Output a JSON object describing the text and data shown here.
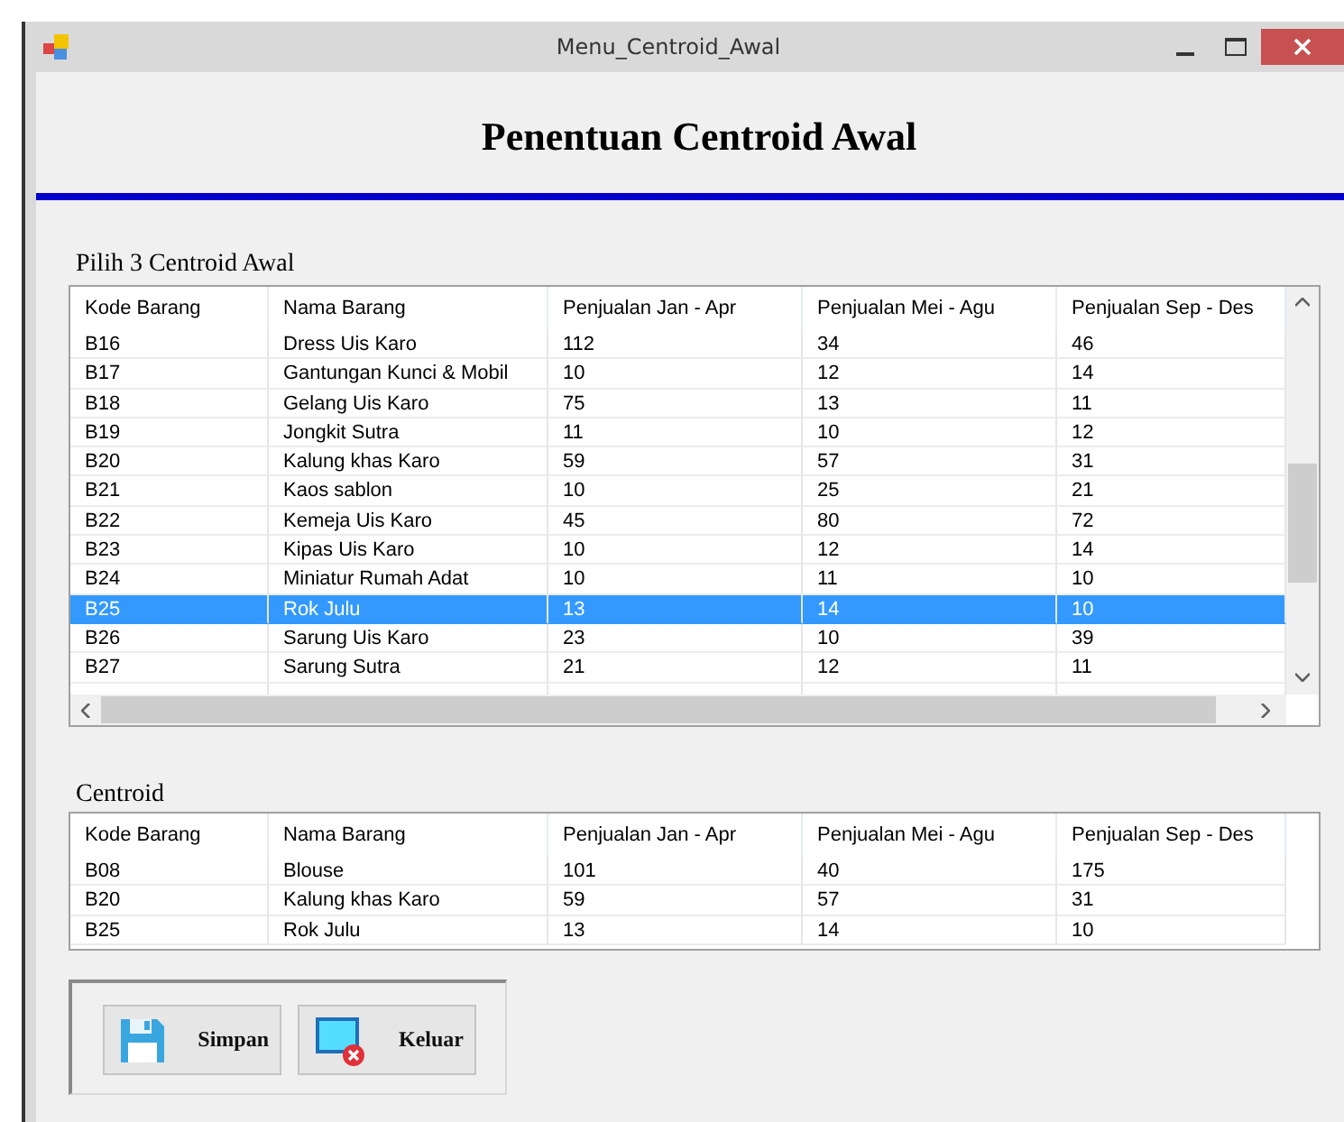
{
  "window": {
    "title": "Menu_Centroid_Awal"
  },
  "heading": "Penentuan Centroid Awal",
  "pick_grid": {
    "label": "Pilih 3 Centroid Awal",
    "columns": [
      "Kode Barang",
      "Nama Barang",
      "Penjualan Jan - Apr",
      "Penjualan Mei - Agu",
      "Penjualan Sep - Des"
    ],
    "rows": [
      {
        "cells": [
          "B16",
          "Dress Uis Karo",
          "112",
          "34",
          "46"
        ],
        "selected": false
      },
      {
        "cells": [
          "B17",
          "Gantungan Kunci & Mobil",
          "10",
          "12",
          "14"
        ],
        "selected": false
      },
      {
        "cells": [
          "B18",
          "Gelang Uis Karo",
          "75",
          "13",
          "11"
        ],
        "selected": false
      },
      {
        "cells": [
          "B19",
          "Jongkit Sutra",
          "11",
          "10",
          "12"
        ],
        "selected": false
      },
      {
        "cells": [
          "B20",
          "Kalung khas Karo",
          "59",
          "57",
          "31"
        ],
        "selected": false
      },
      {
        "cells": [
          "B21",
          "Kaos sablon",
          "10",
          "25",
          "21"
        ],
        "selected": false
      },
      {
        "cells": [
          "B22",
          "Kemeja Uis Karo",
          "45",
          "80",
          "72"
        ],
        "selected": false
      },
      {
        "cells": [
          "B23",
          "Kipas Uis Karo",
          "10",
          "12",
          "14"
        ],
        "selected": false
      },
      {
        "cells": [
          "B24",
          "Miniatur Rumah Adat",
          "10",
          "11",
          "10"
        ],
        "selected": false
      },
      {
        "cells": [
          "B25",
          "Rok Julu",
          "13",
          "14",
          "10"
        ],
        "selected": true
      },
      {
        "cells": [
          "B26",
          "Sarung Uis Karo",
          "23",
          "10",
          "39"
        ],
        "selected": false
      },
      {
        "cells": [
          "B27",
          "Sarung Sutra",
          "21",
          "12",
          "11"
        ],
        "selected": false
      }
    ]
  },
  "centroid_grid": {
    "label": "Centroid",
    "columns": [
      "Kode Barang",
      "Nama Barang",
      "Penjualan Jan - Apr",
      "Penjualan Mei - Agu",
      "Penjualan Sep - Des"
    ],
    "rows": [
      {
        "cells": [
          "B08",
          "Blouse",
          "101",
          "40",
          "175"
        ]
      },
      {
        "cells": [
          "B20",
          "Kalung khas Karo",
          "59",
          "57",
          "31"
        ]
      },
      {
        "cells": [
          "B25",
          "Rok Julu",
          "13",
          "14",
          "10"
        ]
      }
    ]
  },
  "buttons": [
    {
      "kind": "save",
      "label": "Simpan"
    },
    {
      "kind": "exit",
      "label": "Keluar"
    }
  ]
}
